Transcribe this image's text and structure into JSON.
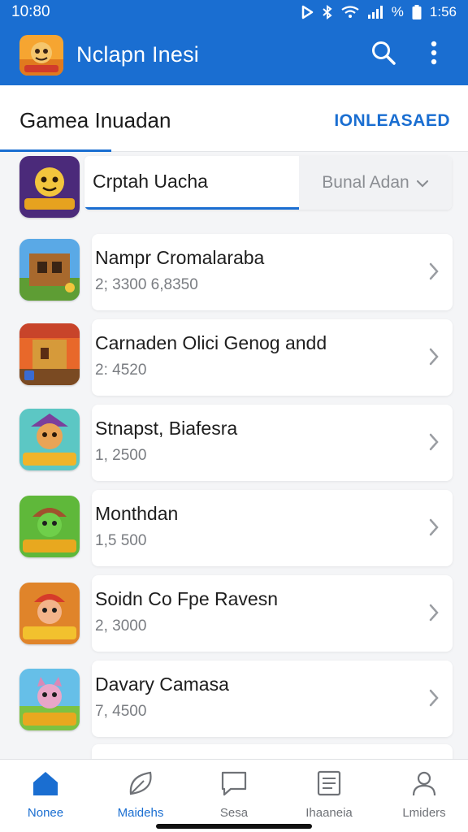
{
  "status_bar": {
    "time": "10:80",
    "right_text": "%",
    "clock": "1:56"
  },
  "app_bar": {
    "title": "Nclapn Inesi",
    "icons": [
      "search-icon",
      "more-vert-icon"
    ]
  },
  "tabs": {
    "active_label": "Gamea Inuadan",
    "right_label": "IONLEASAED"
  },
  "current_game": {
    "name": "Crptah Uacha",
    "filter_label": "Bunal Adan",
    "progress_fraction": 0.6
  },
  "games": [
    {
      "title": "Nampr Cromalaraba",
      "subtitle": "2; 3300  6,8350",
      "icon": "game-cabin-icon"
    },
    {
      "title": "Carnaden Olici Genog andd",
      "subtitle": "2: 4520",
      "icon": "game-treehouse-icon"
    },
    {
      "title": "Stnapst, Biafesra",
      "subtitle": "1, 2500",
      "icon": "game-pirate-icon"
    },
    {
      "title": "Monthdan",
      "subtitle": "1,5 500",
      "icon": "game-turtle-icon"
    },
    {
      "title": "Soidn Co Fpe Ravesn",
      "subtitle": "2, 3000",
      "icon": "game-girl-icon"
    },
    {
      "title": "Davary Camasa",
      "subtitle": "7, 4500",
      "icon": "game-cat-icon"
    }
  ],
  "bottom_nav": [
    {
      "label": "Nonee",
      "icon": "home-icon",
      "active": true
    },
    {
      "label": "Maidehs",
      "icon": "leaf-icon",
      "active": false
    },
    {
      "label": "Sesa",
      "icon": "message-icon",
      "active": false
    },
    {
      "label": "Ihaaneia",
      "icon": "document-icon",
      "active": false
    },
    {
      "label": "Lmiders",
      "icon": "user-icon",
      "active": false
    }
  ],
  "colors": {
    "primary": "#1a6ed1",
    "background": "#f4f5f7"
  }
}
